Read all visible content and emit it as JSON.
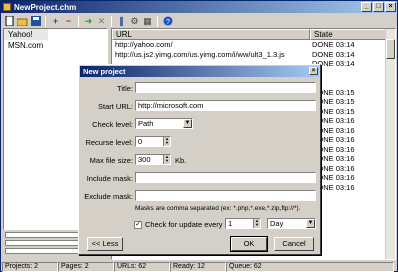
{
  "window": {
    "title": "NewProject.chm"
  },
  "toolbar": {
    "icons": [
      "new-icon",
      "open-icon",
      "save-icon",
      "add-icon",
      "remove-icon",
      "run-icon",
      "stop-icon",
      "pause-icon",
      "settings-icon",
      "filter-icon",
      "help-icon"
    ]
  },
  "projects": [
    "Yahoo!",
    "MSN.com"
  ],
  "list": {
    "col_url": "URL",
    "col_state": "State",
    "rows": [
      {
        "url": "http://yahoo.com/",
        "state": "DONE 03:14"
      },
      {
        "url": "http://us.js2.yimg.com/us.yimg.com/i/ww/ult3_1.3.js",
        "state": "DONE 03:14"
      },
      {
        "url": "",
        "state": "DONE 03:14"
      },
      {
        "url": "",
        "state": ""
      },
      {
        "url": "",
        "state": ""
      },
      {
        "url": "",
        "state": "DONE 03:15"
      },
      {
        "url": "",
        "state": "DONE 03:15"
      },
      {
        "url": "",
        "state": "DONE 03:15"
      },
      {
        "url": "",
        "state": "DONE 03:16"
      },
      {
        "url": "",
        "state": "DONE 03:16"
      },
      {
        "url": "",
        "state": "DONE 03:16"
      },
      {
        "url": "",
        "state": "DONE 03:16"
      },
      {
        "url": "",
        "state": "DONE 03:16"
      },
      {
        "url": "",
        "state": "DONE 03:16"
      },
      {
        "url": "",
        "state": "DONE 03:16"
      },
      {
        "url": "",
        "state": "DONE 03:16"
      }
    ]
  },
  "status": {
    "projects": "Projects: 2",
    "pages": "Pages: 2",
    "urls": "URLs: 62",
    "ready": "Ready: 12",
    "queue": "Queue: 62"
  },
  "dialog": {
    "title": "New project",
    "title_label": "Title:",
    "title_value": "",
    "start_url_label": "Start URL:",
    "start_url_value": "http://microsoft.com",
    "check_level_label": "Check level:",
    "check_level_value": "Path",
    "recurse_label": "Recurse level:",
    "recurse_value": "0",
    "max_size_label": "Max file size:",
    "max_size_value": "300",
    "max_size_unit": "Kb.",
    "include_label": "Include mask:",
    "exclude_label": "Exclude mask:",
    "mask_note": "Masks are comma separated (ex: *.php,*.exe,*.zip,ftp://*).",
    "check_update_label": "Check for update every",
    "check_update_num": "1",
    "check_update_unit": "Day",
    "less_btn": "<< Less",
    "ok_btn": "OK",
    "cancel_btn": "Cancel"
  }
}
